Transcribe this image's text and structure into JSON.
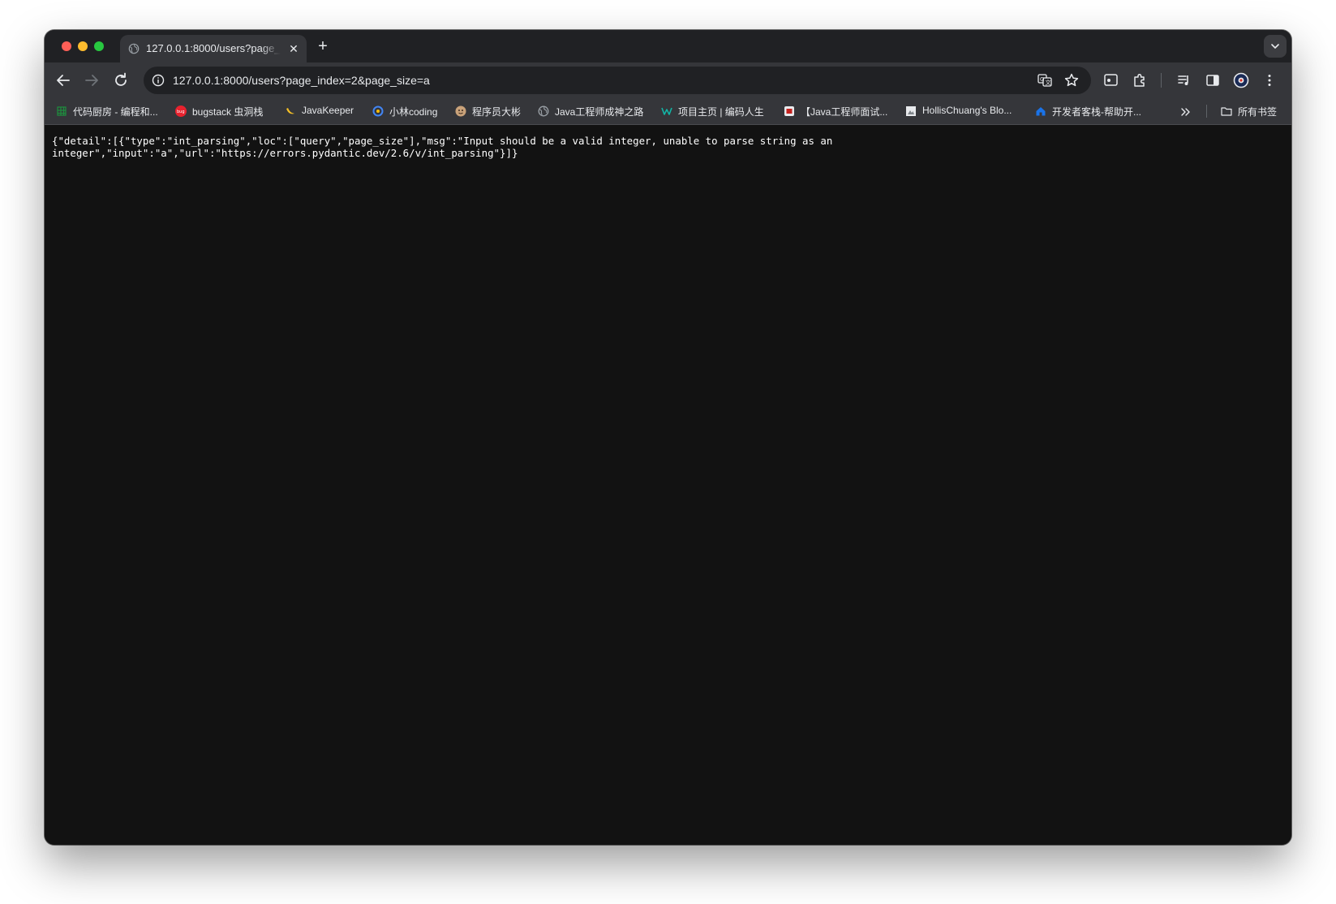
{
  "tab": {
    "title": "127.0.0.1:8000/users?page_index=2&page_size=a"
  },
  "omnibox": {
    "url": "127.0.0.1:8000/users?page_index=2&page_size=a"
  },
  "extension_badge": "1",
  "bookmarks": [
    {
      "label": "代码厨房 - 编程和...",
      "icon": "grid-icon",
      "color": "#1e8e3e"
    },
    {
      "label": "bugstack 虫洞栈",
      "icon": "bug-icon",
      "color": "#e8222e"
    },
    {
      "label": "JavaKeeper",
      "icon": "banana-icon",
      "color": "#f6c026"
    },
    {
      "label": "小林coding",
      "icon": "coding-icon",
      "color": "#4285f4"
    },
    {
      "label": "程序员大彬",
      "icon": "avatar-icon",
      "color": "#c9a27a"
    },
    {
      "label": "Java工程师成神之路",
      "icon": "globe-icon",
      "color": "#9aa0a6"
    },
    {
      "label": "项目主页 | 编码人生",
      "icon": "w-icon",
      "color": "#12b5a6"
    },
    {
      "label": "【Java工程师面试...",
      "icon": "doc-icon",
      "color": "#e8eaed"
    },
    {
      "label": "HollisChuang's Blo...",
      "icon": "image-icon",
      "color": "#e8eaed"
    },
    {
      "label": "开发者客栈-帮助开...",
      "icon": "house-icon",
      "color": "#1a73e8"
    }
  ],
  "all_bookmarks": {
    "label": "所有书签"
  },
  "page": {
    "json_text": "{\"detail\":[{\"type\":\"int_parsing\",\"loc\":[\"query\",\"page_size\"],\"msg\":\"Input should be a valid integer, unable to parse string as an integer\",\"input\":\"a\",\"url\":\"https://errors.pydantic.dev/2.6/v/int_parsing\"}]}"
  }
}
